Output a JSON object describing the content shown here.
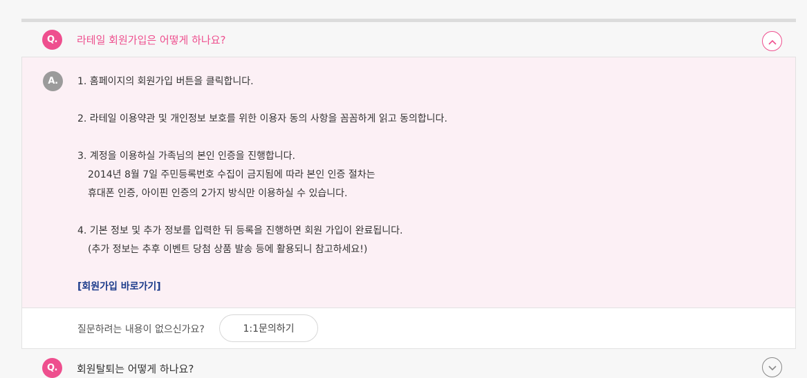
{
  "question": {
    "badge": "Q.",
    "text": "라테일 회원가입은 어떻게 하나요?",
    "toggle_icon": "chevron-up-icon"
  },
  "answer": {
    "badge": "A.",
    "lines": [
      "1. 홈페이지의 회원가입 버튼을 클릭합니다.",
      "2. 라테일 이용약관 및 개인정보 보호를 위한 이용자 동의 사항을 꼼꼼하게 읽고 동의합니다.",
      "3. 계정을 이용하실 가족님의 본인 인증을 진행합니다.",
      "2014년 8월 7일 주민등록번호 수집이 금지됨에 따라 본인 인증 절차는",
      "휴대폰 인증, 아이핀 인증의 2가지 방식만 이용하실 수 있습니다.",
      "4. 기본 정보 및 추가 정보를 입력한 뒤 등록을 진행하면 회원 가입이 완료됩니다.",
      "(추가 정보는 추후 이벤트 당첨 상품 발송 등에 활용되니 참고하세요!)"
    ],
    "link": "[회원가입 바로가기]"
  },
  "help": {
    "text": "질문하려는 내용이 없으신가요?",
    "button": "1:1문의하기"
  },
  "next_question": {
    "badge": "Q.",
    "text": "회원탈퇴는 어떻게 하나요?"
  },
  "colors": {
    "accent": "#ee4f8e",
    "answer_bg": "#fcf0f5",
    "link": "#1a3a8a"
  }
}
